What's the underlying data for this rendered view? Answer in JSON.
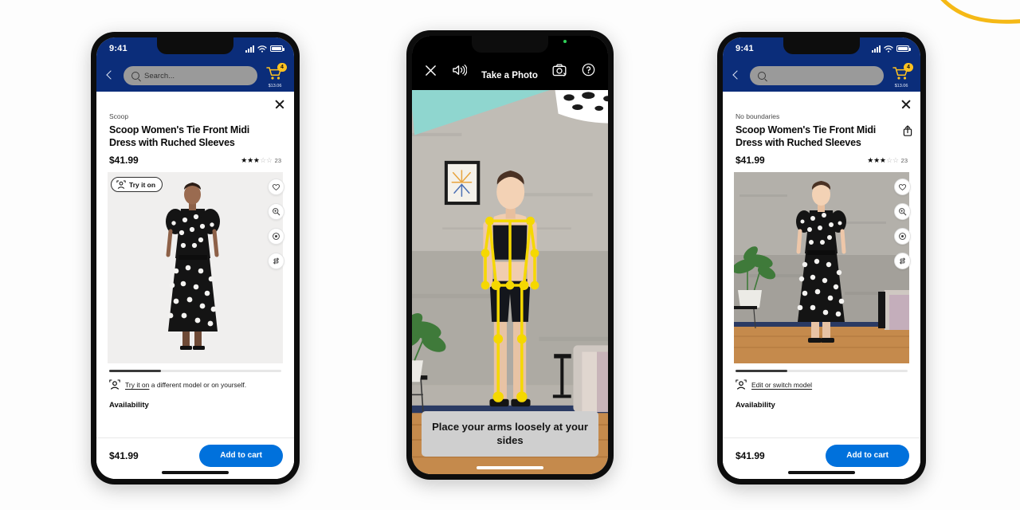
{
  "page": {
    "background": "#fdfdfd",
    "accent_blue": "#0071dc",
    "nav_navy": "#0b2d7a",
    "badge_yellow": "#ffc220",
    "arc_yellow": "#f5b916"
  },
  "phone_left": {
    "status": {
      "time": "9:41",
      "signal_icon": "cellular-signal-icon",
      "wifi_icon": "wifi-icon",
      "battery_icon": "battery-icon"
    },
    "nav": {
      "back_icon": "back-chevron-icon",
      "search_placeholder": "Search...",
      "search_value": "",
      "search_icon": "search-icon",
      "cart_icon": "shopping-cart-icon",
      "cart_count": "4",
      "cart_total": "$13.06"
    },
    "sheet": {
      "close_icon": "close-icon",
      "brand": "Scoop",
      "title": "Scoop Women's Tie Front Midi Dress with Ruched Sleeves",
      "price": "$41.99",
      "rating_filled": 3,
      "rating_total": 5,
      "review_count": "23",
      "tryon_pill_label": "Try it on",
      "tryon_pill_icon": "body-scan-icon",
      "side_actions": [
        {
          "name": "favorite-icon",
          "glyph": "heart"
        },
        {
          "name": "zoom-icon",
          "glyph": "magnifier"
        },
        {
          "name": "360-view-icon",
          "glyph": "play-circle"
        },
        {
          "name": "compare-icon",
          "glyph": "swap"
        }
      ],
      "carousel_progress": 30,
      "tryon_link": "Try it on",
      "tryon_rest": " a different model or on yourself.",
      "tryon_icon": "body-scan-icon",
      "availability_label": "Availability",
      "footer_price": "$41.99",
      "add_to_cart_label": "Add to cart"
    },
    "product_image": {
      "alt": "model in black polka dot midi dress on white studio background"
    }
  },
  "phone_center": {
    "camera_indicator": "camera-active-dot",
    "toolbar": {
      "close_icon": "close-icon",
      "sound_icon": "sound-on-icon",
      "title": "Take a Photo",
      "flip_camera_icon": "flip-camera-icon",
      "help_icon": "help-circle-icon"
    },
    "caption": "Place your arms loosely at your sides",
    "scene": {
      "alt": "person standing against concrete wall in a room with yellow pose-tracking skeleton overlay",
      "skeleton_color": "#f5d800"
    }
  },
  "phone_right": {
    "status": {
      "time": "9:41",
      "signal_icon": "cellular-signal-icon",
      "wifi_icon": "wifi-icon",
      "battery_icon": "battery-icon"
    },
    "nav": {
      "back_icon": "back-chevron-icon",
      "search_placeholder": "",
      "search_value": "",
      "search_icon": "search-icon",
      "cart_icon": "shopping-cart-icon",
      "cart_count": "4",
      "cart_total": "$13.06"
    },
    "sheet": {
      "close_icon": "close-icon",
      "brand": "No boundaries",
      "title": "Scoop Women's Tie Front Midi Dress with Ruched Sleeves",
      "share_icon": "share-icon",
      "price": "$41.99",
      "rating_filled": 3,
      "rating_total": 5,
      "review_count": "23",
      "side_actions": [
        {
          "name": "favorite-icon",
          "glyph": "heart"
        },
        {
          "name": "zoom-icon",
          "glyph": "magnifier"
        },
        {
          "name": "360-view-icon",
          "glyph": "play-circle"
        },
        {
          "name": "compare-icon",
          "glyph": "swap"
        }
      ],
      "carousel_progress": 30,
      "edit_model_link": "Edit or switch model",
      "edit_model_icon": "body-scan-icon",
      "availability_label": "Availability",
      "footer_price": "$41.99",
      "add_to_cart_label": "Add to cart"
    },
    "product_image": {
      "alt": "virtual try-on result: user wearing black polka dot midi dress in her room"
    }
  }
}
